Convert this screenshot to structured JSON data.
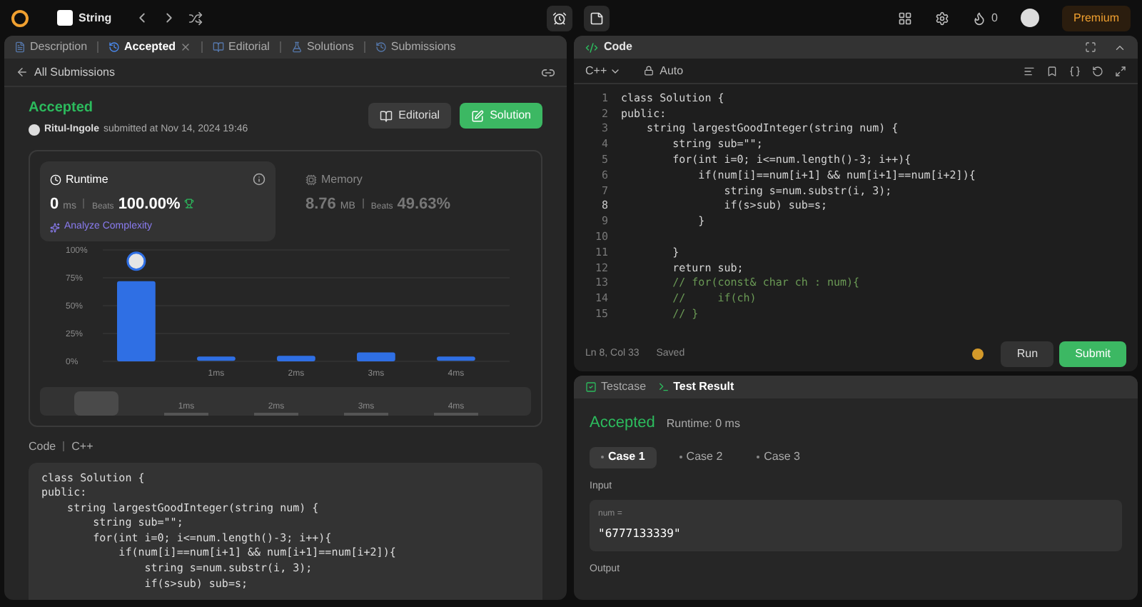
{
  "topbar": {
    "problem_list": "String",
    "streak": "0",
    "premium": "Premium"
  },
  "left_tabs": [
    {
      "label": "Description",
      "selected": false,
      "closable": false
    },
    {
      "label": "Accepted",
      "selected": true,
      "closable": true
    },
    {
      "label": "Editorial",
      "selected": false,
      "closable": false
    },
    {
      "label": "Solutions",
      "selected": false,
      "closable": false
    },
    {
      "label": "Submissions",
      "selected": false,
      "closable": false
    }
  ],
  "back_link": "All Submissions",
  "submission": {
    "status": "Accepted",
    "user": "Ritul-Ingole",
    "submitted": "submitted at Nov 14, 2024 19:46",
    "buttons": [
      "Editorial",
      "Solution"
    ]
  },
  "runtime": {
    "title": "Runtime",
    "value": "0",
    "unit": "ms",
    "beats_label": "Beats",
    "beats": "100.00%",
    "analyze": "Analyze Complexity",
    "selected": true
  },
  "memory": {
    "title": "Memory",
    "value": "8.76",
    "unit": "MB",
    "beats_label": "Beats",
    "beats": "49.63%",
    "selected": false
  },
  "chart": {
    "chart_data": {
      "type": "bar",
      "grid": true,
      "categories": [
        null,
        "1ms",
        "2ms",
        "3ms",
        "4ms"
      ],
      "values": [
        72,
        3,
        5,
        8,
        3
      ],
      "ylim": [
        0,
        100
      ],
      "yticks": [
        {
          "value": 0,
          "label": "0%"
        },
        {
          "value": 25,
          "label": "25%"
        },
        {
          "value": 50,
          "label": "50%"
        },
        {
          "value": 75,
          "label": "75%"
        },
        {
          "value": 100,
          "label": "100%"
        }
      ]
    },
    "overview_labels": [
      "1ms",
      "2ms",
      "3ms",
      "4ms"
    ]
  },
  "code_section": {
    "label": "Code",
    "language": "C++",
    "lines": [
      {
        "text": "class Solution {"
      },
      {
        "text": "public:"
      },
      {
        "text": "    string largestGoodInteger(string num) {"
      },
      {
        "text": "        string sub=\"\";"
      },
      {
        "text": "        for(int i=0; i<=num.length()-3; i++){"
      },
      {
        "text": "            if(num[i]==num[i+1] && num[i+1]==num[i+2]){"
      },
      {
        "text": "                string s=num.substr(i, 3);"
      },
      {
        "text": "                if(s>sub) sub=s;"
      }
    ]
  },
  "editor": {
    "title": "Code",
    "language": "C++",
    "mode": "Auto",
    "status": "Ln 8, Col 33",
    "saved": "Saved",
    "run": "Run",
    "submit": "Submit",
    "lines": [
      {
        "number": "1",
        "text": "class Solution {",
        "kind": "code"
      },
      {
        "number": "2",
        "text": "public:",
        "kind": "code"
      },
      {
        "number": "3",
        "text": "    string largestGoodInteger(string num) {",
        "kind": "code"
      },
      {
        "number": "4",
        "text": "        string sub=\"\";",
        "kind": "code"
      },
      {
        "number": "5",
        "text": "        for(int i=0; i<=num.length()-3; i++){",
        "kind": "code"
      },
      {
        "number": "6",
        "text": "            if(num[i]==num[i+1] && num[i+1]==num[i+2]){",
        "kind": "code"
      },
      {
        "number": "7",
        "text": "                string s=num.substr(i, 3);",
        "kind": "code"
      },
      {
        "number": "8",
        "text": "                if(s>sub) sub=s;",
        "kind": "code"
      },
      {
        "number": "9",
        "text": "            }",
        "kind": "code"
      },
      {
        "number": "10"
      },
      {
        "number": "11",
        "text": "        }",
        "kind": "code"
      },
      {
        "number": "12",
        "text": "        return sub;",
        "kind": "code"
      },
      {
        "number": "13",
        "text": "        // for(const& char ch : num){",
        "kind": "comment"
      },
      {
        "number": "14",
        "text": "        //     if(ch)",
        "kind": "comment"
      },
      {
        "number": "15",
        "text": "        // }",
        "kind": "comment"
      }
    ]
  },
  "result": {
    "tabs": [
      {
        "label": "Testcase",
        "selected": false
      },
      {
        "label": "Test Result",
        "selected": true
      }
    ],
    "status": "Accepted",
    "runtime": "Runtime: 0 ms",
    "cases": [
      {
        "label": "Case 1",
        "selected": true
      },
      {
        "label": "Case 2",
        "selected": false
      },
      {
        "label": "Case 3",
        "selected": false
      }
    ],
    "input_label": "Input",
    "param": "num =",
    "value": "\"6777133339\"",
    "output_label": "Output"
  }
}
